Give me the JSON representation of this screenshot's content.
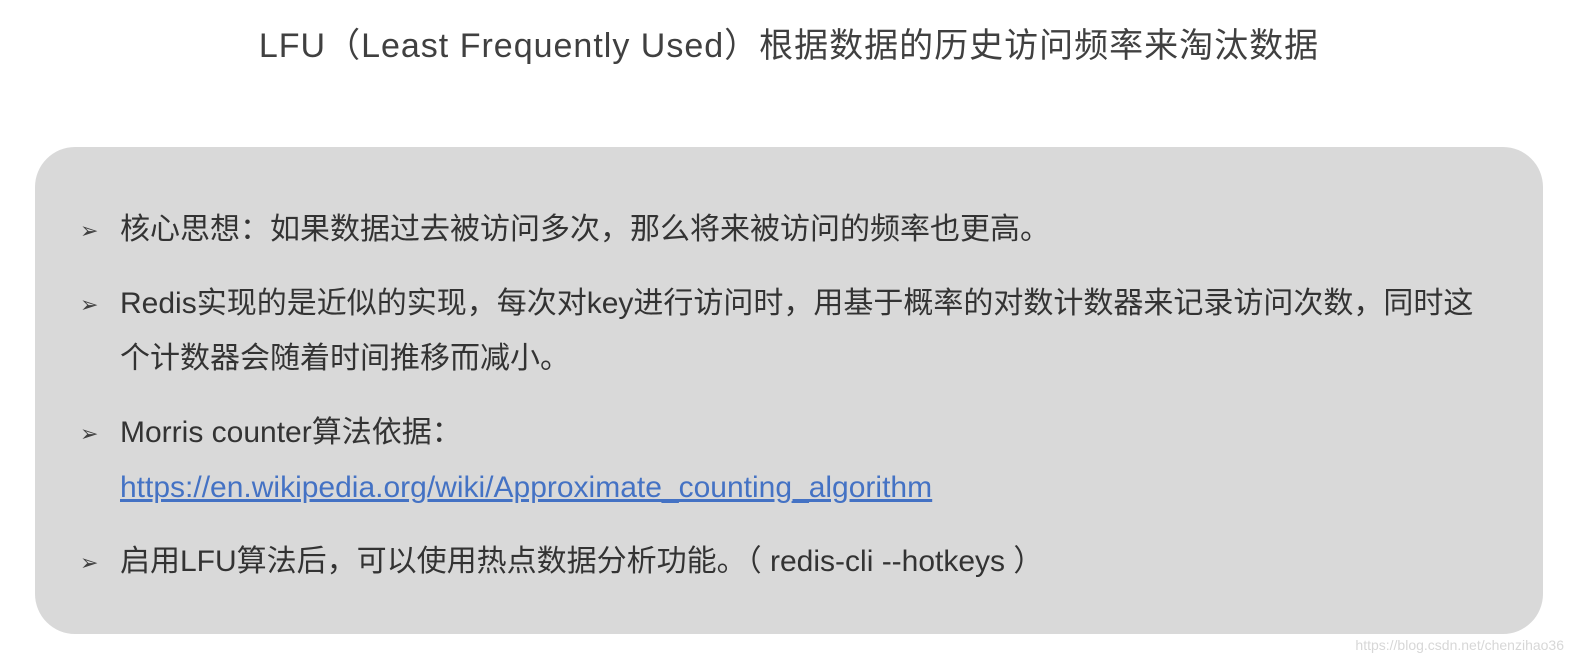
{
  "title": "LFU（Least Frequently Used）根据数据的历史访问频率来淘汰数据",
  "bullets": {
    "b1": "核心思想：如果数据过去被访问多次，那么将来被访问的频率也更高。",
    "b2": "Redis实现的是近似的实现，每次对key进行访问时，用基于概率的对数计数器来记录访问次数，同时这个计数器会随着时间推移而减小。",
    "b3_prefix": "Morris counter算法依据：",
    "b3_link": "https://en.wikipedia.org/wiki/Approximate_counting_algorithm",
    "b4": "启用LFU算法后，可以使用热点数据分析功能。（ redis-cli --hotkeys ）"
  },
  "marker": "➢",
  "watermark": "https://blog.csdn.net/chenzihao36"
}
